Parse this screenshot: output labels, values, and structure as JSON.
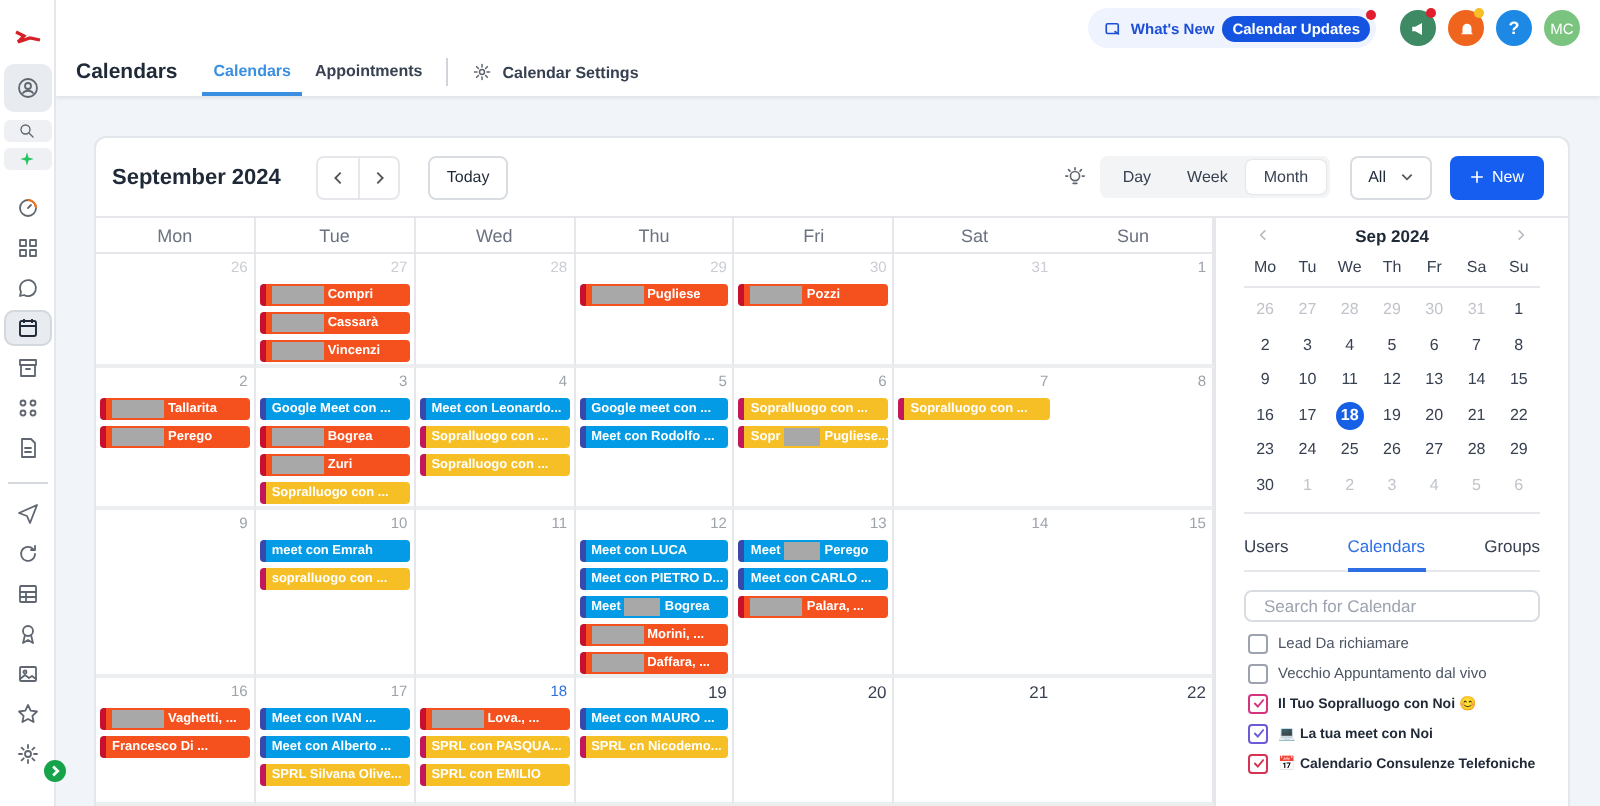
{
  "sidebar": {
    "items": [
      {
        "selected": false
      },
      {
        "selected": false
      },
      {
        "selected": false
      },
      {
        "selected": false
      },
      {
        "selected": false
      },
      {
        "selected": false
      },
      {
        "selected": true
      },
      {
        "selected": false
      },
      {
        "selected": false
      },
      {
        "selected": false
      },
      {
        "selected": false
      },
      {
        "selected": false
      },
      {
        "selected": false
      },
      {
        "selected": false
      },
      {
        "selected": false
      },
      {
        "selected": false
      },
      {
        "selected": false
      }
    ]
  },
  "header": {
    "title": "Calendars",
    "tabs": [
      {
        "label": "Calendars",
        "selected": true
      },
      {
        "label": "Appointments",
        "selected": false
      }
    ],
    "settings_link": "Calendar Settings",
    "whats_new": "What's New",
    "updates_badge": "Calendar Updates",
    "help": "?",
    "avatar": "MC"
  },
  "toolbar": {
    "month": "September 2024",
    "today": "Today",
    "views": [
      {
        "label": "Day",
        "selected": false
      },
      {
        "label": "Week",
        "selected": false
      },
      {
        "label": "Month",
        "selected": true
      }
    ],
    "filter": "All",
    "new_button": "New"
  },
  "month_grid": {
    "weekdays": [
      "Mon",
      "Tue",
      "Wed",
      "Thu",
      "Fri",
      "Sat",
      "Sun"
    ],
    "weeks": [
      [
        {
          "day": "26",
          "kind": "outside"
        },
        {
          "day": "27",
          "kind": "outside",
          "events": [
            {
              "text": "Compri",
              "redacted": true,
              "color": "#f4511e"
            },
            {
              "text": "Cassarà",
              "redacted": true,
              "color": "#f4511e"
            },
            {
              "text": "Vincenzi",
              "redacted": true,
              "color": "#f4511e"
            }
          ]
        },
        {
          "day": "28",
          "kind": "outside"
        },
        {
          "day": "29",
          "kind": "outside",
          "events": [
            {
              "text": "Pugliese",
              "redacted": true,
              "color": "#f4511e"
            }
          ]
        },
        {
          "day": "30",
          "kind": "outside",
          "events": [
            {
              "text": "Pozzi",
              "redacted": true,
              "color": "#f4511e"
            }
          ]
        },
        {
          "day": "31",
          "kind": "outside"
        },
        {
          "day": "1",
          "kind": "past"
        }
      ],
      [
        {
          "day": "2",
          "kind": "past",
          "events": [
            {
              "text": "Tallarita",
              "redacted": true,
              "color": "#f4511e"
            },
            {
              "text": "Perego",
              "redacted": true,
              "color": "#f4511e"
            }
          ]
        },
        {
          "day": "3",
          "kind": "past",
          "events": [
            {
              "text": "Google Meet con ...",
              "redacted": false,
              "color": "#039be5"
            },
            {
              "text": "Bogrea",
              "redacted": true,
              "color": "#f4511e"
            },
            {
              "text": "Zuri",
              "redacted": true,
              "color": "#f4511e"
            },
            {
              "text": "Sopralluogo con ...",
              "redacted": false,
              "color": "#f6bf26"
            }
          ]
        },
        {
          "day": "4",
          "kind": "past",
          "events": [
            {
              "text": "Meet con Leonardo...",
              "redacted": false,
              "color": "#039be5"
            },
            {
              "text": "Sopralluogo con ...",
              "redacted": false,
              "color": "#f6bf26"
            },
            {
              "text": "Sopralluogo con ...",
              "redacted": false,
              "color": "#f6bf26"
            }
          ]
        },
        {
          "day": "5",
          "kind": "past",
          "events": [
            {
              "text": "Google meet con ...",
              "redacted": false,
              "color": "#039be5"
            },
            {
              "text": "Meet con Rodolfo ...",
              "redacted": false,
              "color": "#039be5"
            }
          ]
        },
        {
          "day": "6",
          "kind": "past",
          "events": [
            {
              "text": "Sopralluogo con ...",
              "redacted": false,
              "color": "#f6bf26"
            },
            {
              "prefix": "Sopr",
              "text": "Pugliese...",
              "redacted": true,
              "color": "#f6bf26"
            }
          ]
        },
        {
          "day": "7",
          "kind": "past",
          "events": [
            {
              "text": "Sopralluogo con ...",
              "redacted": false,
              "color": "#f6bf26"
            }
          ]
        },
        {
          "day": "8",
          "kind": "past"
        }
      ],
      [
        {
          "day": "9",
          "kind": "past"
        },
        {
          "day": "10",
          "kind": "past",
          "events": [
            {
              "text": "meet con Emrah",
              "redacted": false,
              "color": "#039be5"
            },
            {
              "text": "sopralluogo con ...",
              "redacted": false,
              "color": "#f6bf26"
            }
          ]
        },
        {
          "day": "11",
          "kind": "past"
        },
        {
          "day": "12",
          "kind": "past",
          "events": [
            {
              "text": "Meet con LUCA",
              "redacted": false,
              "color": "#039be5"
            },
            {
              "text": "Meet con PIETRO D...",
              "redacted": false,
              "color": "#039be5"
            },
            {
              "prefix": "Meet",
              "text": "Bogrea",
              "redacted": true,
              "color": "#039be5"
            },
            {
              "text": "Morini, ...",
              "redacted": true,
              "color": "#f4511e"
            },
            {
              "text": "Daffara, ...",
              "redacted": true,
              "color": "#f4511e"
            }
          ]
        },
        {
          "day": "13",
          "kind": "past",
          "events": [
            {
              "prefix": "Meet",
              "text": "Perego",
              "redacted": true,
              "color": "#039be5"
            },
            {
              "text": "Meet con CARLO ...",
              "redacted": false,
              "color": "#039be5"
            },
            {
              "text": "Palara, ...",
              "redacted": true,
              "color": "#f4511e"
            }
          ]
        },
        {
          "day": "14",
          "kind": "past"
        },
        {
          "day": "15",
          "kind": "past"
        }
      ],
      [
        {
          "day": "16",
          "kind": "past",
          "events": [
            {
              "text": "Vaghetti, ...",
              "redacted": true,
              "color": "#f4511e"
            },
            {
              "text": "Francesco Di ...",
              "redacted": false,
              "color": "#f4511e"
            }
          ]
        },
        {
          "day": "17",
          "kind": "past",
          "events": [
            {
              "text": "Meet con IVAN ...",
              "redacted": false,
              "color": "#039be5"
            },
            {
              "text": "Meet con Alberto ...",
              "redacted": false,
              "color": "#039be5"
            },
            {
              "text": "SPRL Silvana Olive...",
              "redacted": false,
              "color": "#f6bf26"
            }
          ]
        },
        {
          "day": "18",
          "kind": "today",
          "events": [
            {
              "text": "Lova., ...",
              "redacted": true,
              "color": "#f4511e"
            },
            {
              "text": "SPRL con PASQUA...",
              "redacted": false,
              "color": "#f6bf26"
            },
            {
              "text": "SPRL con EMILIO",
              "redacted": false,
              "color": "#f6bf26"
            }
          ]
        },
        {
          "day": "19",
          "kind": "upcoming",
          "events": [
            {
              "text": "Meet con MAURO ...",
              "redacted": false,
              "color": "#039be5"
            },
            {
              "text": "SPRL cn Nicodemo...",
              "redacted": false,
              "color": "#f6bf26"
            }
          ]
        },
        {
          "day": "20",
          "kind": "upcoming"
        },
        {
          "day": "21",
          "kind": "upcoming"
        },
        {
          "day": "22",
          "kind": "upcoming"
        }
      ]
    ]
  },
  "mini_calendar": {
    "title": "Sep 2024",
    "weekdays": [
      "Mo",
      "Tu",
      "We",
      "Th",
      "Fr",
      "Sa",
      "Su"
    ],
    "weeks": [
      [
        {
          "day": "26",
          "outside": true,
          "selected": false
        },
        {
          "day": "27",
          "outside": true,
          "selected": false
        },
        {
          "day": "28",
          "outside": true,
          "selected": false
        },
        {
          "day": "29",
          "outside": true,
          "selected": false
        },
        {
          "day": "30",
          "outside": true,
          "selected": false
        },
        {
          "day": "31",
          "outside": true,
          "selected": false
        },
        {
          "day": "1",
          "outside": false,
          "selected": false
        }
      ],
      [
        {
          "day": "2",
          "outside": false,
          "selected": false
        },
        {
          "day": "3",
          "outside": false,
          "selected": false
        },
        {
          "day": "4",
          "outside": false,
          "selected": false
        },
        {
          "day": "5",
          "outside": false,
          "selected": false
        },
        {
          "day": "6",
          "outside": false,
          "selected": false
        },
        {
          "day": "7",
          "outside": false,
          "selected": false
        },
        {
          "day": "8",
          "outside": false,
          "selected": false
        }
      ],
      [
        {
          "day": "9",
          "outside": false,
          "selected": false
        },
        {
          "day": "10",
          "outside": false,
          "selected": false
        },
        {
          "day": "11",
          "outside": false,
          "selected": false
        },
        {
          "day": "12",
          "outside": false,
          "selected": false
        },
        {
          "day": "13",
          "outside": false,
          "selected": false
        },
        {
          "day": "14",
          "outside": false,
          "selected": false
        },
        {
          "day": "15",
          "outside": false,
          "selected": false
        }
      ],
      [
        {
          "day": "16",
          "outside": false,
          "selected": false
        },
        {
          "day": "17",
          "outside": false,
          "selected": false
        },
        {
          "day": "18",
          "outside": false,
          "selected": true
        },
        {
          "day": "19",
          "outside": false,
          "selected": false
        },
        {
          "day": "20",
          "outside": false,
          "selected": false
        },
        {
          "day": "21",
          "outside": false,
          "selected": false
        },
        {
          "day": "22",
          "outside": false,
          "selected": false
        }
      ],
      [
        {
          "day": "23",
          "outside": false,
          "selected": false
        },
        {
          "day": "24",
          "outside": false,
          "selected": false
        },
        {
          "day": "25",
          "outside": false,
          "selected": false
        },
        {
          "day": "26",
          "outside": false,
          "selected": false
        },
        {
          "day": "27",
          "outside": false,
          "selected": false
        },
        {
          "day": "28",
          "outside": false,
          "selected": false
        },
        {
          "day": "29",
          "outside": false,
          "selected": false
        }
      ],
      [
        {
          "day": "30",
          "outside": false,
          "selected": false
        },
        {
          "day": "1",
          "outside": true,
          "selected": false
        },
        {
          "day": "2",
          "outside": true,
          "selected": false
        },
        {
          "day": "3",
          "outside": true,
          "selected": false
        },
        {
          "day": "4",
          "outside": true,
          "selected": false
        },
        {
          "day": "5",
          "outside": true,
          "selected": false
        },
        {
          "day": "6",
          "outside": true,
          "selected": false
        }
      ]
    ]
  },
  "panel_tabs": [
    {
      "label": "Users",
      "selected": false
    },
    {
      "label": "Calendars",
      "selected": true
    },
    {
      "label": "Groups",
      "selected": false
    }
  ],
  "calendar_search": {
    "placeholder": "Search for Calendar"
  },
  "calendar_list": [
    {
      "label": "Lead Da richiamare",
      "checked": false
    },
    {
      "label": "Vecchio Appuntamento dal vivo",
      "checked": false
    },
    {
      "label": "Il Tuo Sopralluogo con Noi 😊",
      "checked": true,
      "color": "#d6337f"
    },
    {
      "label": "💻 La tua meet con Noi",
      "checked": true,
      "color": "#6b5bd6"
    },
    {
      "label": "📅 Calendario Consulenze Telefoniche",
      "checked": true,
      "color": "#d63354"
    }
  ]
}
